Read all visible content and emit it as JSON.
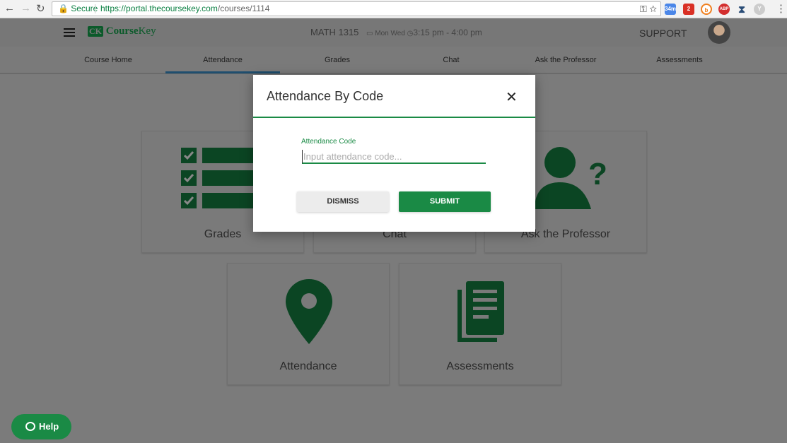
{
  "browser": {
    "secure_label": "Secure",
    "url_host": "https://portal.thecoursekey.com",
    "url_path": "/courses/1114",
    "extensions": [
      {
        "name": "calendar",
        "badge": "34m",
        "color": "#4a86e8"
      },
      {
        "name": "gmail",
        "badge": "2",
        "color": "#d93025"
      },
      {
        "name": "b-extension",
        "color": "#f07f1e"
      },
      {
        "name": "adblock-plus",
        "badge": "ABP",
        "color": "#d32f2f"
      },
      {
        "name": "hourglass",
        "color": "#2a4d77"
      },
      {
        "name": "y-extension",
        "color": "#bbbbbb"
      }
    ]
  },
  "header": {
    "logo_text_bold": "Course",
    "logo_text": "Key",
    "logo_mark": "CK",
    "course": "MATH 1315",
    "days": "Mon Wed",
    "time": "3:15 pm - 4:00 pm",
    "support": "SUPPORT"
  },
  "tabs": [
    {
      "label": "Course Home"
    },
    {
      "label": "Attendance",
      "active": true
    },
    {
      "label": "Grades"
    },
    {
      "label": "Chat"
    },
    {
      "label": "Ask the Professor"
    },
    {
      "label": "Assessments"
    }
  ],
  "cards": [
    {
      "label": "Grades",
      "icon": "checklist-icon"
    },
    {
      "label": "Chat",
      "icon": "chat-icon"
    },
    {
      "label": "Ask the Professor",
      "icon": "person-question-icon"
    },
    {
      "label": "Attendance",
      "icon": "map-pin-icon"
    },
    {
      "label": "Assessments",
      "icon": "documents-icon"
    }
  ],
  "modal": {
    "title": "Attendance By Code",
    "field_label": "Attendance Code",
    "placeholder": "Input attendance code...",
    "value": "",
    "dismiss": "DISMISS",
    "submit": "SUBMIT"
  },
  "help": {
    "label": "Help"
  },
  "colors": {
    "accent": "#1a8a45",
    "icon_green": "#0b4523",
    "active_tab": "#1f4e6e"
  }
}
